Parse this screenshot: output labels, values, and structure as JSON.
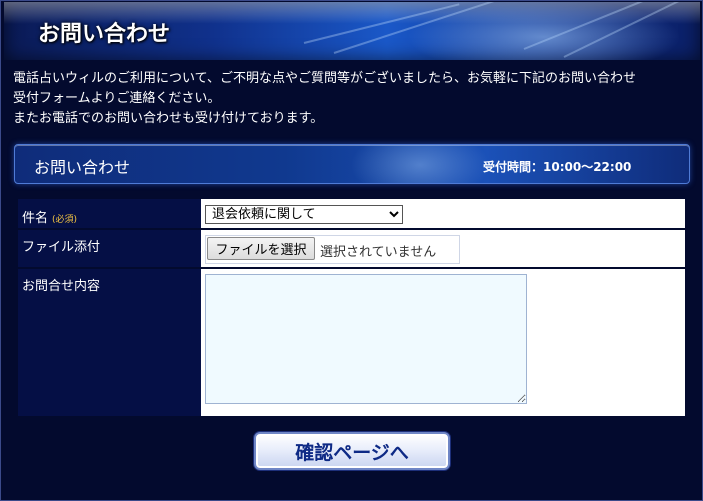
{
  "header": {
    "title": "お問い合わせ"
  },
  "intro": {
    "line1": "電話占いウィルのご利用について、ご不明な点やご質問等がございましたら、お気軽に下記のお問い合わせ",
    "line2": "受付フォームよりご連絡ください。",
    "line3": "またお電話でのお問い合わせも受け付けております。"
  },
  "section": {
    "title": "お問い合わせ",
    "hours": "受付時間：10:00〜22:00"
  },
  "form": {
    "subject_label": "件名",
    "required_mark": "(必須)",
    "subject_selected": "退会依頼に関して",
    "file_label": "ファイル添付",
    "file_button": "ファイルを選択",
    "file_status": "選択されていません",
    "content_label": "お問合せ内容",
    "content_value": ""
  },
  "confirm_button": "確認ページへ",
  "colors": {
    "background": "#030a2e",
    "label_bg": "#050f45",
    "required": "#f5c542",
    "button_text": "#0e2a86"
  }
}
